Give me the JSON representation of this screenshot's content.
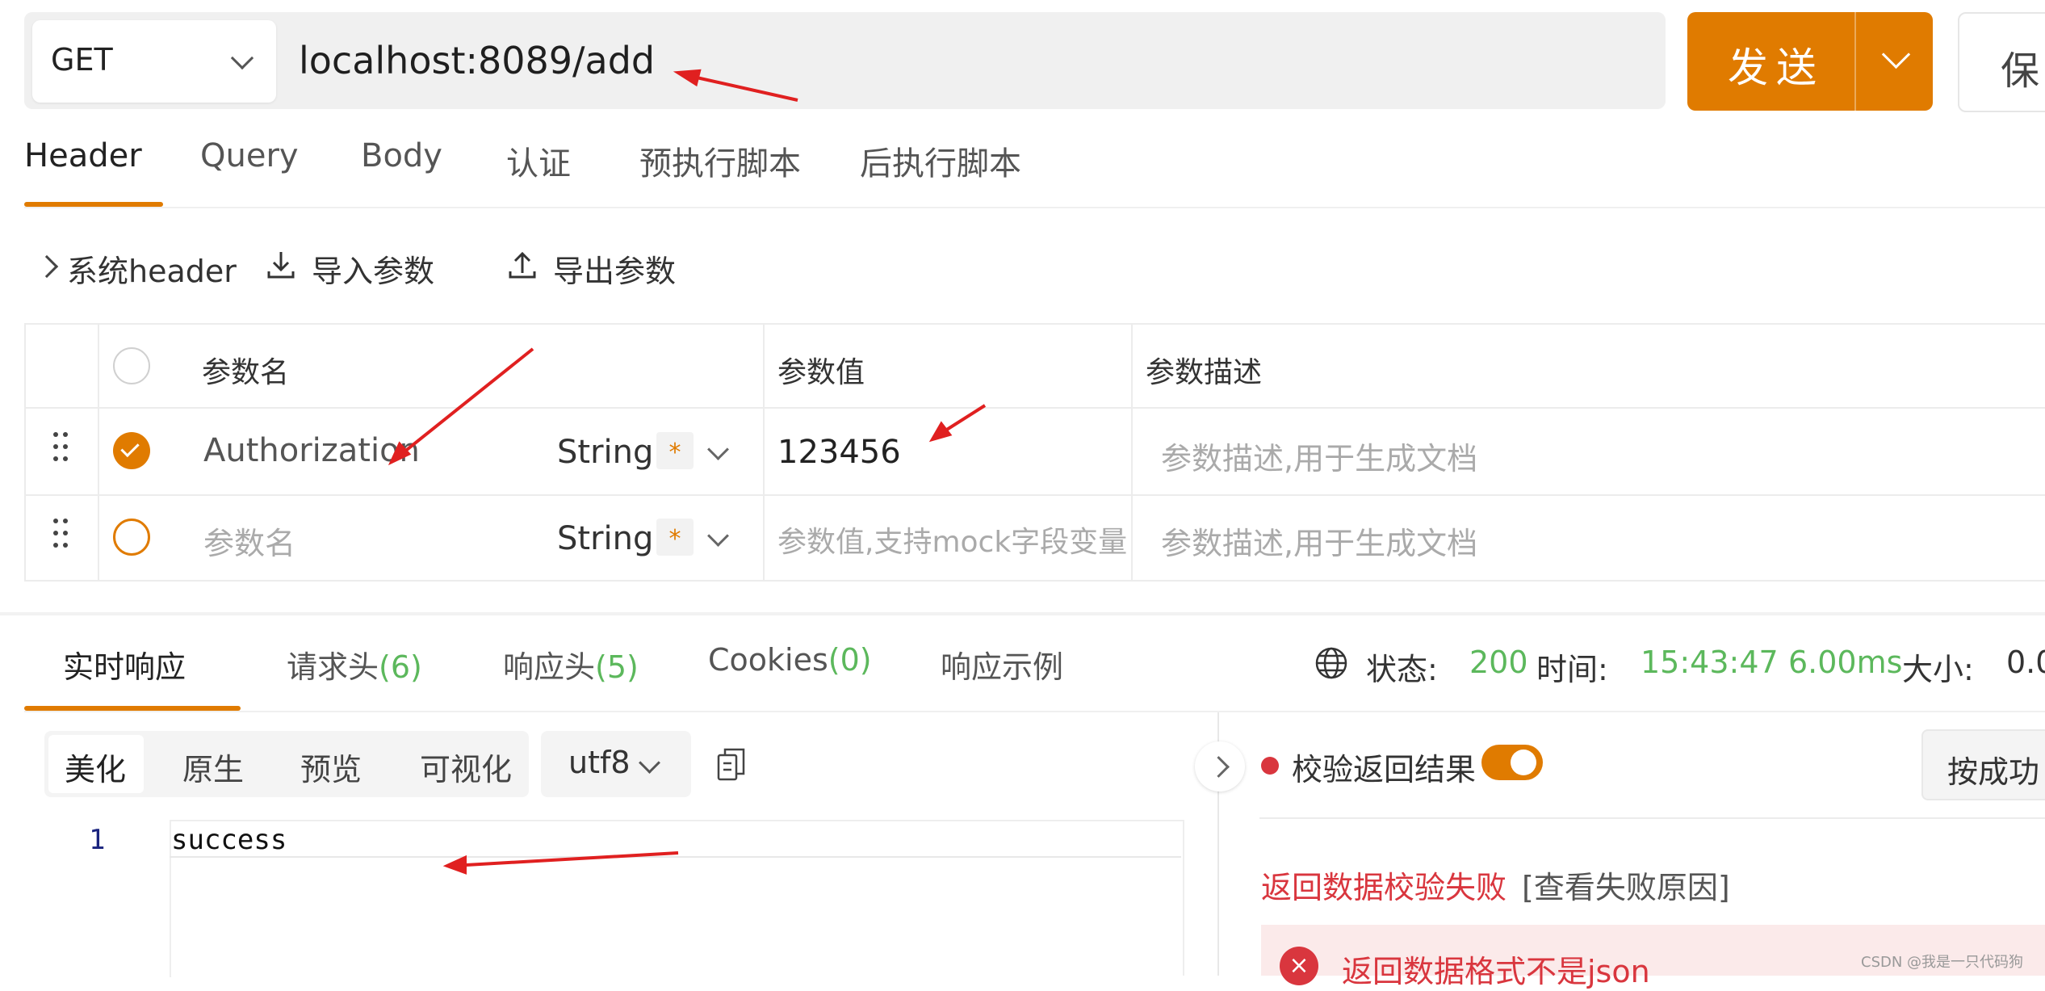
{
  "request": {
    "method": "GET",
    "url": "localhost:8089/add",
    "send_label": "发送",
    "save_label": "保"
  },
  "request_tabs": [
    {
      "label": "Header",
      "active": true
    },
    {
      "label": "Query"
    },
    {
      "label": "Body"
    },
    {
      "label": "认证"
    },
    {
      "label": "预执行脚本"
    },
    {
      "label": "后执行脚本"
    }
  ],
  "header_toolbar": {
    "system_header": "系统header",
    "import": "导入参数",
    "export": "导出参数"
  },
  "param_table": {
    "columns": [
      "参数名",
      "参数值",
      "参数描述"
    ],
    "rows": [
      {
        "checked": true,
        "name": "Authorization",
        "type": "String",
        "required_mark": "*",
        "value": "123456",
        "description_placeholder": "参数描述,用于生成文档"
      },
      {
        "checked": false,
        "name_placeholder": "参数名",
        "type": "String",
        "required_mark": "*",
        "value_placeholder": "参数值,支持mock字段变量",
        "description_placeholder": "参数描述,用于生成文档"
      }
    ]
  },
  "response_tabs": [
    {
      "label": "实时响应",
      "active": true
    },
    {
      "label": "请求头",
      "count": "(6)"
    },
    {
      "label": "响应头",
      "count": "(5)"
    },
    {
      "label": "Cookies",
      "count": "(0)"
    },
    {
      "label": "响应示例"
    }
  ],
  "response_status": {
    "status_label": "状态:",
    "status_value": "200",
    "time_label": "时间:",
    "time_value": "15:43:47",
    "duration": "6.00ms",
    "size_label": "大小:",
    "size_value": "0.0"
  },
  "view_modes": [
    "美化",
    "原生",
    "预览",
    "可视化"
  ],
  "encoding": "utf8",
  "editor": {
    "line_number": "1",
    "content": "success"
  },
  "validation": {
    "label": "校验返回结果",
    "enabled": true,
    "success_button": "按成功",
    "fail_text": "返回数据校验失败",
    "fail_link": "[查看失败原因]",
    "error_icon": "×",
    "error_text": "返回数据格式不是json"
  },
  "watermark": "CSDN @我是一只代码狗",
  "colors": {
    "accent": "#e07b00",
    "success": "#5cb85c",
    "error": "#d9363e",
    "annotation_arrow": "#e02020"
  }
}
